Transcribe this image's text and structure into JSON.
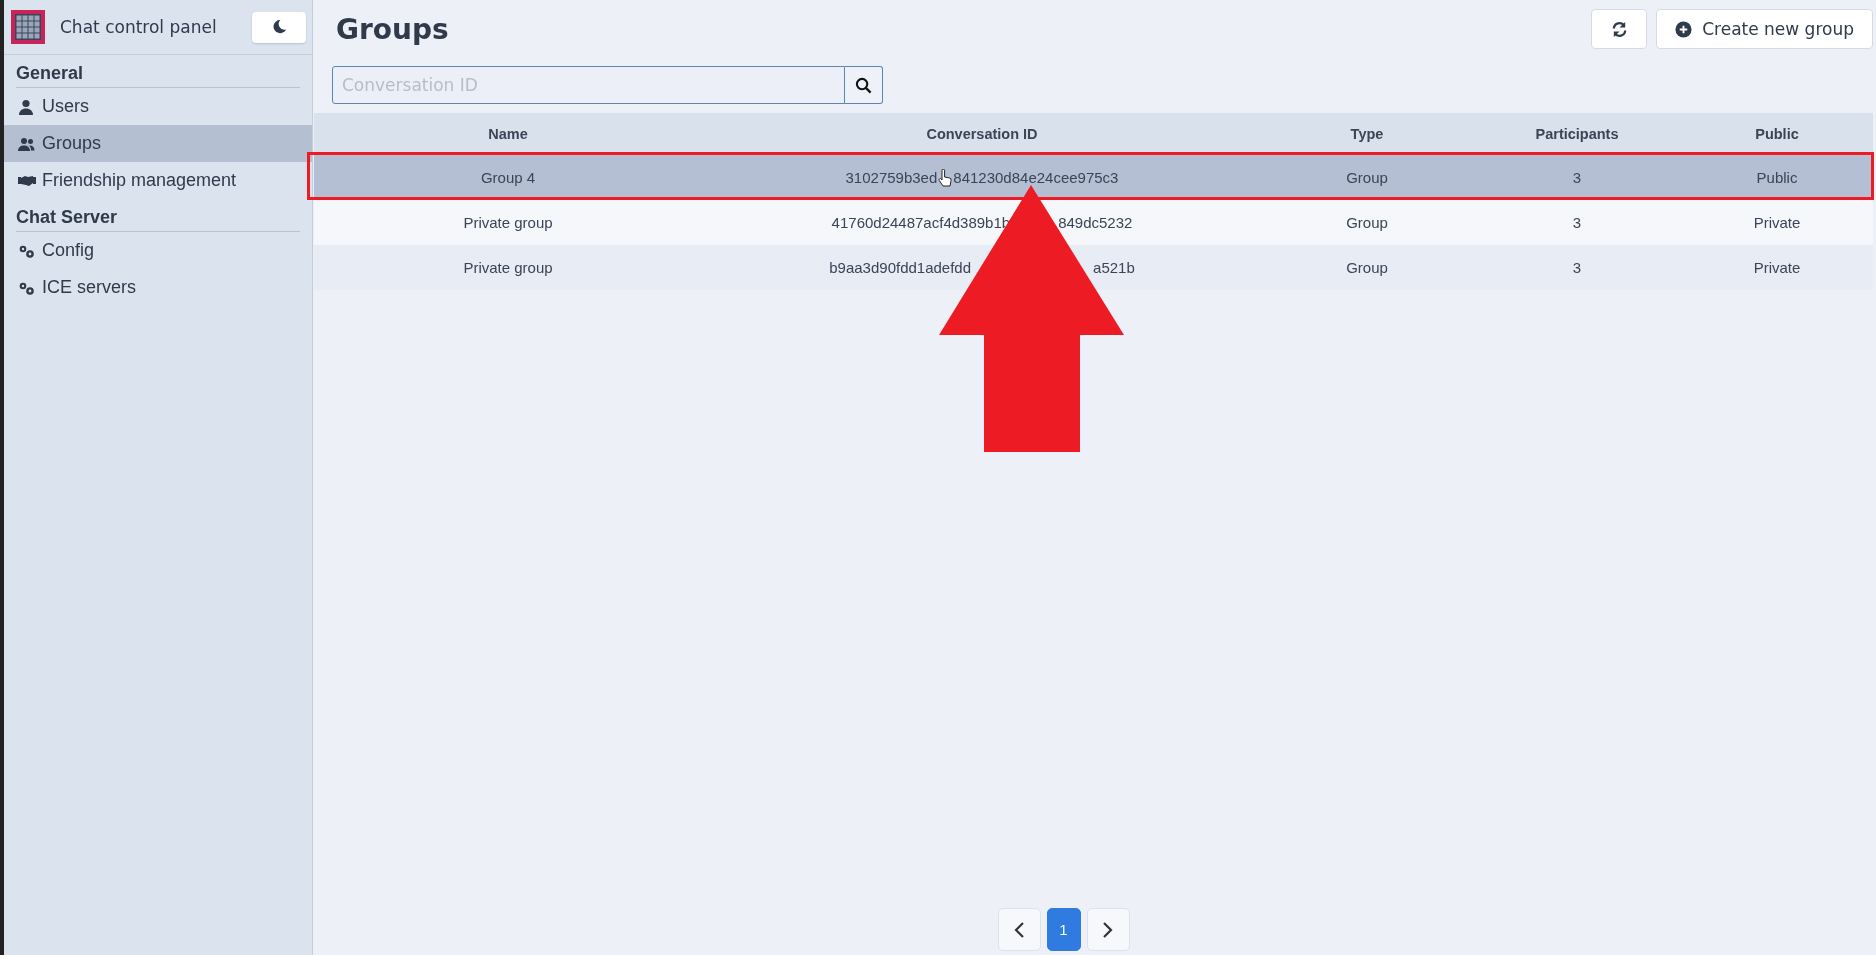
{
  "sidebar": {
    "title": "Chat control panel",
    "sections": [
      {
        "heading": "General",
        "items": [
          {
            "label": "Users",
            "kind": "user",
            "selected": false
          },
          {
            "label": "Groups",
            "kind": "users",
            "selected": true
          },
          {
            "label": "Friendship management",
            "kind": "handshake",
            "selected": false
          }
        ]
      },
      {
        "heading": "Chat Server",
        "items": [
          {
            "label": "Config",
            "kind": "gears",
            "selected": false
          },
          {
            "label": "ICE servers",
            "kind": "gears",
            "selected": false
          }
        ]
      }
    ]
  },
  "page": {
    "title": "Groups",
    "buttons": [
      {
        "kind": "refresh"
      },
      {
        "kind": "create",
        "label": "Create new group"
      }
    ]
  },
  "search": {
    "placeholder": "Conversation ID"
  },
  "table": {
    "columns": [
      "Name",
      "Conversation ID",
      "Type",
      "Participants",
      "Public"
    ],
    "rows": [
      {
        "name": "Group 4",
        "conversation_id": [
          "3102759b3ed",
          "841230d84e24cee975c3"
        ],
        "type": "Group",
        "participants": "3",
        "public": "Public",
        "hovered": true
      },
      {
        "name": "Private group",
        "conversation_id": [
          "41760d24487acf4d389b1b",
          "849dc5232"
        ],
        "type": "Group",
        "participants": "3",
        "public": "Private",
        "hovered": false
      },
      {
        "name": "Private group",
        "conversation_id": [
          "b9aa3d90fdd1adefdd",
          "a521b"
        ],
        "type": "Group",
        "participants": "3",
        "public": "Private",
        "hovered": false
      }
    ]
  },
  "pagination": {
    "pages": [
      {
        "label": "1",
        "selected": true
      }
    ]
  },
  "annotations": {
    "highlight_box": true,
    "arrow": true
  }
}
